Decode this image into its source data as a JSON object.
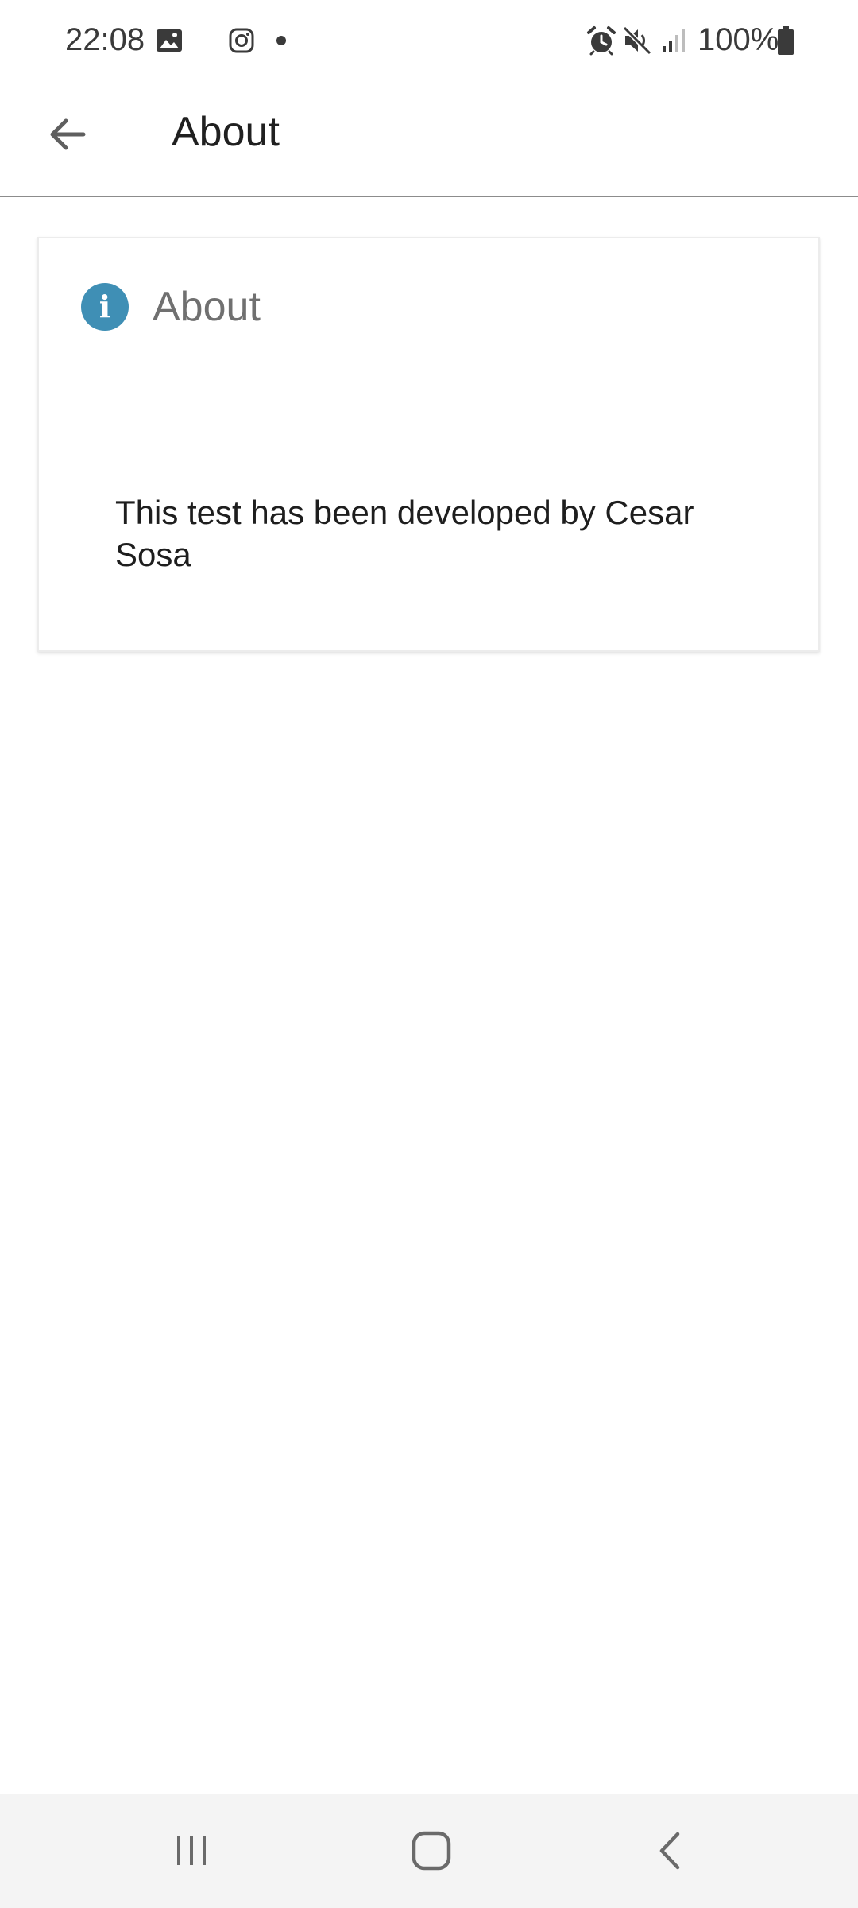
{
  "status_bar": {
    "time": "22:08",
    "battery": "100%",
    "icons_left": [
      "gallery-icon",
      "instagram-icon",
      "dot-icon"
    ],
    "icons_right": [
      "alarm-icon",
      "mute-icon",
      "signal-icon",
      "battery-icon"
    ]
  },
  "app_bar": {
    "title": "About",
    "back_icon": "arrow-back-icon"
  },
  "card": {
    "icon": "info-icon",
    "icon_glyph": "i",
    "title": "About",
    "body": "This test has been developed by Cesar Sosa"
  },
  "nav_bar": {
    "buttons": [
      "recents-icon",
      "home-icon",
      "back-icon"
    ]
  },
  "colors": {
    "info_accent": "#3f8fb5",
    "nav_background": "#f4f4f4",
    "divider": "#8c8c8c"
  }
}
